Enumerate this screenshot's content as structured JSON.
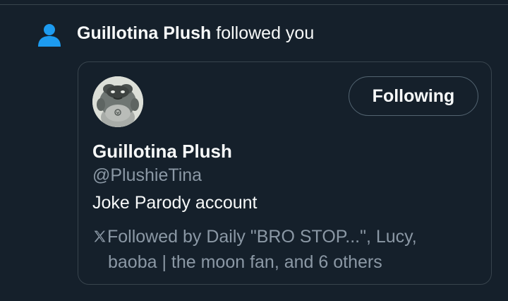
{
  "notification": {
    "icon": "person-icon",
    "actor_name": "Guillotina Plush",
    "action_text": " followed you"
  },
  "profile_card": {
    "avatar": "plush-avatar",
    "display_name": "Guillotina Plush",
    "handle": "@PlushieTina",
    "bio": "Joke Parody account",
    "follow_button_label": "Following",
    "followed_by_line1": "Followed by Daily \"BRO STOP...\", Lucy,",
    "followed_by_line2": "baoba | the moon fan, and 6 others"
  },
  "colors": {
    "background": "#15202b",
    "border": "#38444d",
    "text_primary": "#f7f9f9",
    "text_secondary": "#8b98a5",
    "accent": "#1d9bf0"
  }
}
